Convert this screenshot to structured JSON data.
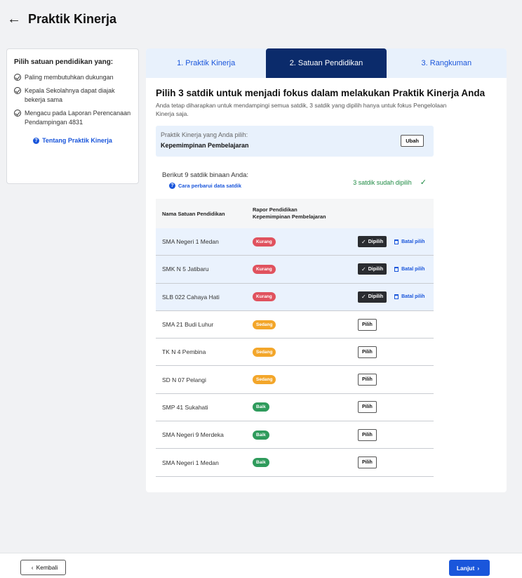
{
  "header": {
    "back_icon": "←",
    "title": "Praktik Kinerja"
  },
  "sidebar": {
    "title": "Pilih satuan pendidikan yang:",
    "items": [
      {
        "label": "Paling membutuhkan dukungan"
      },
      {
        "label": "Kepala Sekolahnya dapat diajak bekerja sama"
      },
      {
        "label": "Mengacu pada Laporan Perencanaan Pendampingan 4831"
      }
    ],
    "link": "Tentang Praktik Kinerja",
    "link_icon": "?"
  },
  "tabs": [
    {
      "label": "1. Praktik Kinerja"
    },
    {
      "label": "2. Satuan Pendidikan"
    },
    {
      "label": "3. Rangkuman"
    }
  ],
  "main": {
    "heading": "Pilih 3 satdik untuk menjadi fokus dalam melakukan Praktik Kinerja Anda",
    "subtext": "Anda tetap diharapkan untuk mendampingi semua satdik, 3 satdik yang dipilih hanya untuk fokus Pengelolaan Kinerja saja.",
    "choice_label": "Praktik Kinerja yang Anda pilih:",
    "choice_value": "Kepemimpinan Pembelajaran",
    "ubah_label": "Ubah",
    "info_label": "Berikut 9 satdik binaan Anda:",
    "info_link": "Cara perbarui data satdik",
    "selected_status": "3 satdik sudah dipilih",
    "check_icon": "✓"
  },
  "table": {
    "col_name": "Nama Satuan Pendidikan",
    "col_rapor_1": "Rapor Pendidikan",
    "col_rapor_2": "Kepemimpinan Pembelajaran",
    "dipilih_label": "Dipilih",
    "batal_label": "Batal pilih",
    "pilih_label": "Pilih",
    "rows": [
      {
        "name": "SMA Negeri 1 Medan",
        "rapor": "Kurang"
      },
      {
        "name": "SMK N 5 Jatibaru",
        "rapor": "Kurang"
      },
      {
        "name": "SLB 022 Cahaya Hati",
        "rapor": "Kurang"
      },
      {
        "name": "SMA 21 Budi Luhur",
        "rapor": "Sedang"
      },
      {
        "name": "TK N 4 Pembina",
        "rapor": "Sedang"
      },
      {
        "name": "SD N 07 Pelangi",
        "rapor": "Sedang"
      },
      {
        "name": "SMP 41 Sukahati",
        "rapor": "Baik"
      },
      {
        "name": "SMA Negeri 9 Merdeka",
        "rapor": "Baik"
      },
      {
        "name": "SMA Negeri 1 Medan",
        "rapor": "Baik"
      }
    ]
  },
  "footer": {
    "back_label": "Kembali",
    "next_label": "Lanjut",
    "back_chevron": "‹",
    "next_chevron": "›"
  },
  "colors": {
    "accent": "#1a56db",
    "active_tab": "#0b2b6b",
    "kurang": "#e0525e",
    "sedang": "#f3a62a",
    "baik": "#2f9b5c",
    "success": "#1e8a43"
  }
}
